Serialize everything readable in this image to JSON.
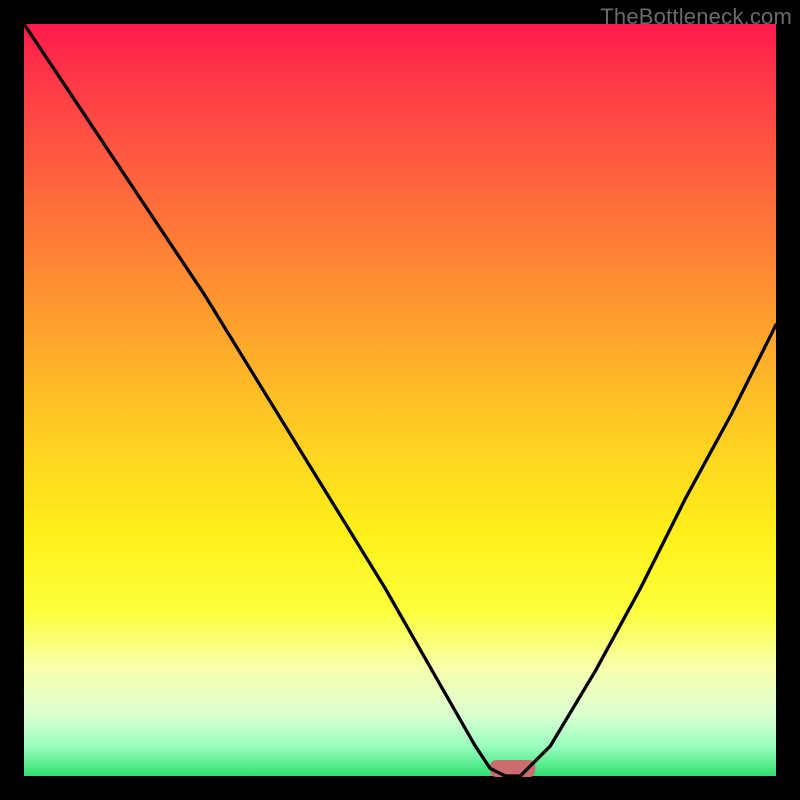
{
  "watermark": "TheBottleneck.com",
  "chart_data": {
    "type": "line",
    "title": "",
    "xlabel": "",
    "ylabel": "",
    "xlim": [
      0,
      100
    ],
    "ylim": [
      0,
      100
    ],
    "grid": false,
    "series": [
      {
        "name": "bottleneck-curve",
        "x": [
          0,
          8,
          16,
          24,
          32,
          40,
          48,
          52,
          56,
          60,
          62,
          64,
          66,
          70,
          76,
          82,
          88,
          94,
          100
        ],
        "values": [
          100,
          88,
          76,
          64,
          51,
          38,
          25,
          18,
          11,
          4,
          1,
          0,
          0,
          4,
          14,
          25,
          37,
          48,
          60
        ]
      }
    ],
    "marker": {
      "name": "optimal-range-pill",
      "x_center": 65,
      "y": 0,
      "width": 6,
      "height": 2,
      "color": "#cc6d6d"
    },
    "gradient_stops": [
      {
        "pos": 0,
        "color": "#ff1a4d"
      },
      {
        "pos": 38,
        "color": "#ff9a2f"
      },
      {
        "pos": 68,
        "color": "#fff01a"
      },
      {
        "pos": 92,
        "color": "#d9ffd0"
      },
      {
        "pos": 100,
        "color": "#30e070"
      }
    ]
  }
}
